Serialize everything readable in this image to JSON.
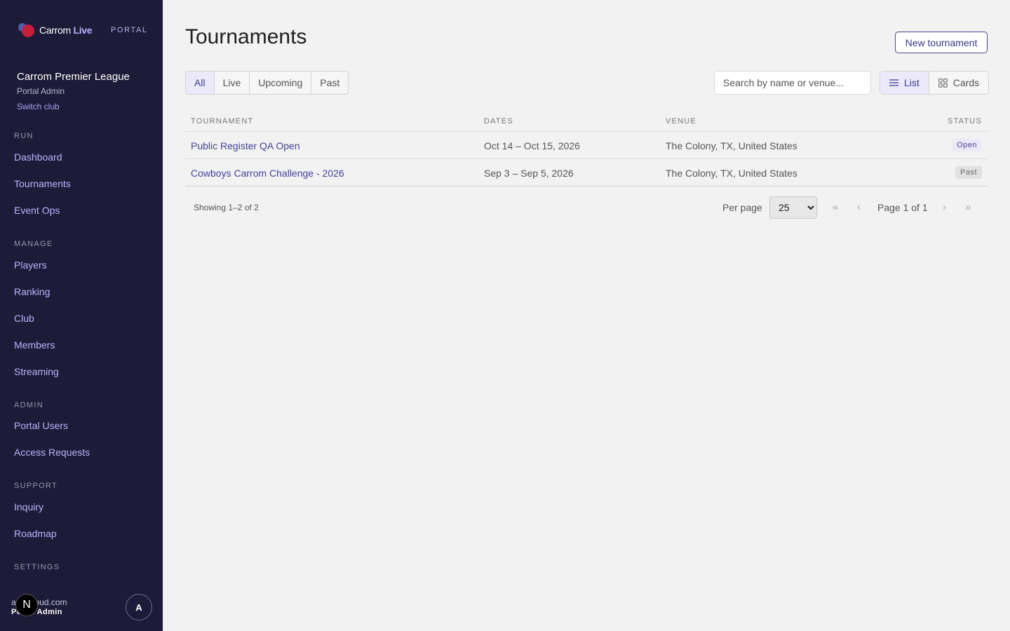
{
  "sidebar": {
    "brand": {
      "word1": "Carrom",
      "word2": "Live"
    },
    "portal_tag": "PORTAL",
    "club": {
      "name": "Carrom Premier League",
      "role": "Portal Admin",
      "switch": "Switch club"
    },
    "sections": {
      "run": "RUN",
      "manage": "MANAGE",
      "admin": "ADMIN",
      "support": "SUPPORT",
      "settings": "SETTINGS"
    },
    "items": {
      "dashboard": "Dashboard",
      "tournaments": "Tournaments",
      "event_ops": "Event Ops",
      "players": "Players",
      "ranking": "Ranking",
      "club": "Club",
      "members": "Members",
      "streaming": "Streaming",
      "portal_users": "Portal Users",
      "access_requests": "Access Requests",
      "inquiry": "Inquiry",
      "roadmap": "Roadmap"
    },
    "user": {
      "email": "a      @icloud.com",
      "role": "Portal Admin",
      "badge": "N",
      "avatar": "A"
    }
  },
  "main": {
    "title": "Tournaments",
    "new_button": "New tournament",
    "filters": [
      "All",
      "Live",
      "Upcoming",
      "Past"
    ],
    "search_placeholder": "Search by name or venue...",
    "view": {
      "list": "List",
      "cards": "Cards"
    },
    "table": {
      "headers": {
        "tournament": "TOURNAMENT",
        "dates": "DATES",
        "venue": "VENUE",
        "status": "STATUS"
      },
      "rows": [
        {
          "name": "Public Register QA Open",
          "dates": "Oct 14 – Oct 15, 2026",
          "venue": "The Colony, TX, United States",
          "status": "Open"
        },
        {
          "name": "Cowboys Carrom Challenge - 2026",
          "dates": "Sep 3 – Sep 5, 2026",
          "venue": "The Colony, TX, United States",
          "status": "Past"
        }
      ]
    },
    "pagination": {
      "showing": "Showing 1–2 of 2",
      "per_page_label": "Per page",
      "per_page_value": "25",
      "first": "«",
      "prev": "‹",
      "page_info": "Page 1 of 1",
      "next": "›",
      "last": "»"
    }
  },
  "colors": {
    "sidebar_bg": "#1d1b37",
    "accent": "#46409a",
    "nav_link": "#b8b3ff"
  }
}
